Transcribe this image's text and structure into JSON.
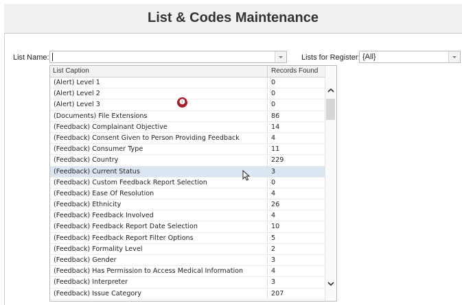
{
  "page": {
    "title": "List & Codes Maintenance"
  },
  "filters": {
    "list_name_label": "List Name:",
    "list_name_value": "",
    "register_label": "Lists for Register:",
    "register_value": "{All}"
  },
  "list": {
    "columns": [
      "List Caption",
      "Records Found"
    ],
    "rows": [
      {
        "caption": "(Alert) Level 1",
        "count": "0"
      },
      {
        "caption": "(Alert) Level 2",
        "count": "0"
      },
      {
        "caption": "(Alert) Level 3",
        "count": "0"
      },
      {
        "caption": "(Documents) File Extensions",
        "count": "86"
      },
      {
        "caption": "(Feedback) Complainant Objective",
        "count": "14"
      },
      {
        "caption": "(Feedback) Consent Given to Person Providing Feedback",
        "count": "4"
      },
      {
        "caption": "(Feedback) Consumer Type",
        "count": "11"
      },
      {
        "caption": "(Feedback) Country",
        "count": "229"
      },
      {
        "caption": "(Feedback) Current Status",
        "count": "3"
      },
      {
        "caption": "(Feedback) Custom Feedback Report Selection",
        "count": "0"
      },
      {
        "caption": "(Feedback) Ease Of Resolution",
        "count": "4"
      },
      {
        "caption": "(Feedback) Ethnicity",
        "count": "26"
      },
      {
        "caption": "(Feedback) Feedback Involved",
        "count": "4"
      },
      {
        "caption": "(Feedback) Feedback Report Date Selection",
        "count": "10"
      },
      {
        "caption": "(Feedback) Feedback Report Filter Options",
        "count": "5"
      },
      {
        "caption": "(Feedback) Formality Level",
        "count": "2"
      },
      {
        "caption": "(Feedback) Gender",
        "count": "3"
      },
      {
        "caption": "(Feedback) Has Permission to Access Medical Information",
        "count": "4"
      },
      {
        "caption": "(Feedback) Interpreter",
        "count": "3"
      },
      {
        "caption": "(Feedback) Issue Category",
        "count": "207"
      }
    ],
    "selected_index": 8
  },
  "annotation": {
    "badge_glyph": "❶"
  }
}
